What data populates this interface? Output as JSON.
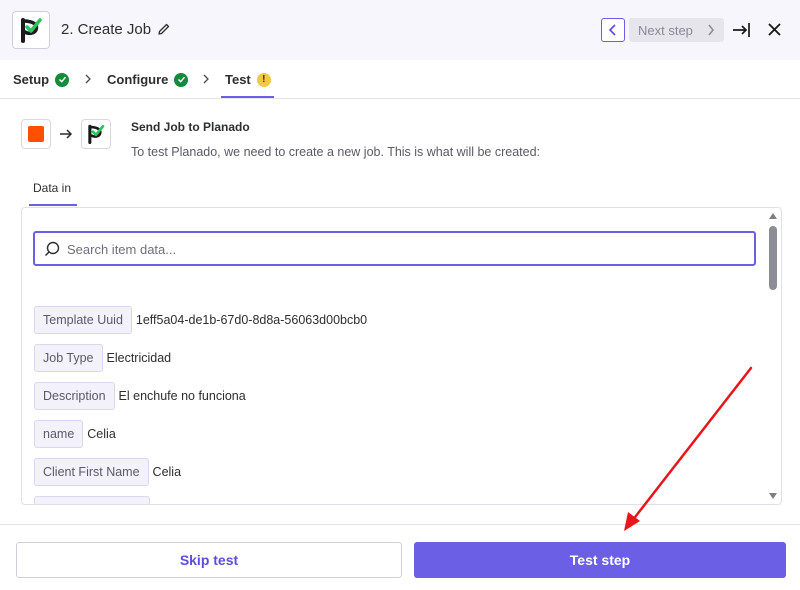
{
  "header": {
    "title": "2. Create Job",
    "next_step_label": "Next step",
    "icons": [
      "planado-logo",
      "pencil-icon",
      "chevron-left-icon",
      "chevron-right-icon",
      "exit-icon",
      "close-icon"
    ]
  },
  "tabs": [
    {
      "label": "Setup",
      "status": "complete"
    },
    {
      "label": "Configure",
      "status": "complete"
    },
    {
      "label": "Test",
      "status": "warning",
      "active": true
    }
  ],
  "test_badge_glyph": "!",
  "action": {
    "title": "Send Job to Planado",
    "subtitle": "To test Planado, we need to create a new job. This is what will be created:"
  },
  "data_tab": {
    "label": "Data in"
  },
  "search": {
    "placeholder": "Search item data..."
  },
  "fields": [
    {
      "key": "Template Uuid",
      "value": "1eff5a04-de1b-67d0-8d8a-56063d00bcb0"
    },
    {
      "key": "Job Type",
      "value": "Electricidad"
    },
    {
      "key": "Description",
      "value": "El enchufe no funciona"
    },
    {
      "key": "name",
      "value": "Celia"
    },
    {
      "key": "Client First Name",
      "value": "Celia"
    }
  ],
  "footer": {
    "skip_label": "Skip test",
    "test_label": "Test step"
  },
  "colors": {
    "accent": "#6b5fe6",
    "success": "#138a3c",
    "warning": "#f3c845",
    "source_app": "#ff4f00",
    "annotation": "#e8161b"
  }
}
